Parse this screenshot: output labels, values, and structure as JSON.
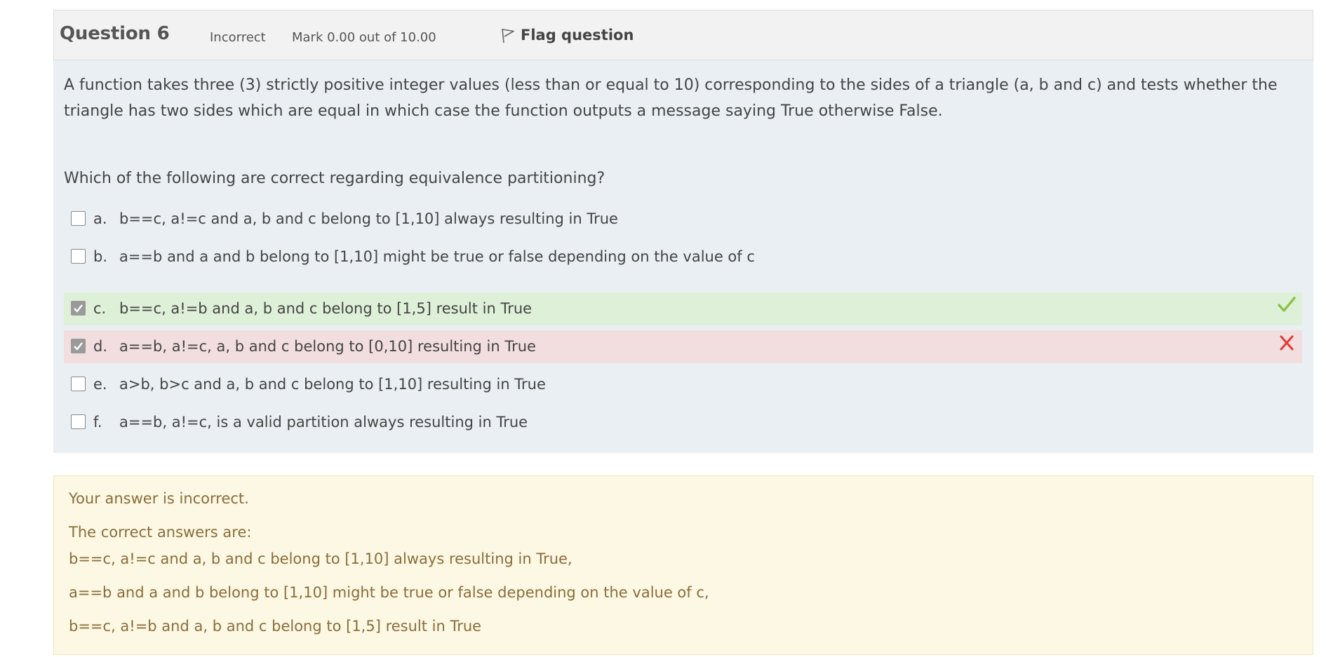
{
  "info": {
    "question_label": "Question 6",
    "state": "Incorrect",
    "grade": "Mark 0.00 out of 10.00",
    "flag_label": "Flag question"
  },
  "question": {
    "text": "A function takes three (3) strictly positive integer values (less than or equal to 10) corresponding to the sides of a triangle (a, b and c) and tests whether the triangle has two sides which are equal in which case the function outputs a message saying True otherwise False.",
    "prompt": "Which of the following are correct regarding equivalence partitioning?"
  },
  "answers": [
    {
      "letter": "a.",
      "text": "b==c, a!=c and a, b and c belong to [1,10] always resulting in True",
      "checked": false,
      "status": "none"
    },
    {
      "letter": "b.",
      "text": "a==b and a and b belong to [1,10] might be true or false depending on the value of c",
      "checked": false,
      "status": "none"
    },
    {
      "letter": "c.",
      "text": "b==c, a!=b and a, b and c belong to [1,5] result in True",
      "checked": true,
      "status": "correct"
    },
    {
      "letter": "d.",
      "text": "a==b, a!=c, a, b and c belong to [0,10] resulting in True",
      "checked": true,
      "status": "incorrect"
    },
    {
      "letter": "e.",
      "text": "a>b, b>c and a, b and c  belong to [1,10] resulting in True",
      "checked": false,
      "status": "none"
    },
    {
      "letter": "f.",
      "text": "a==b, a!=c, is a valid partition always resulting in True",
      "checked": false,
      "status": "none"
    }
  ],
  "feedback": {
    "result": "Your answer is incorrect.",
    "heading": "The correct answers are:",
    "correct_answers": [
      "b==c, a!=c and a, b and c belong to [1,10] always resulting in True,",
      "a==b and a and b belong to [1,10] might be true or false depending on the value of c,",
      "b==c, a!=b and a, b and c belong to [1,5] result in True"
    ]
  },
  "colors": {
    "correct_bg": "#dff0d8",
    "incorrect_bg": "#f2dede",
    "check_mark": "#8bc34a",
    "cross_mark": "#e53935",
    "feedback_text": "#8a6d3b"
  },
  "icons": {
    "flag": "flag-icon",
    "correct": "check-icon",
    "incorrect": "cross-icon"
  }
}
